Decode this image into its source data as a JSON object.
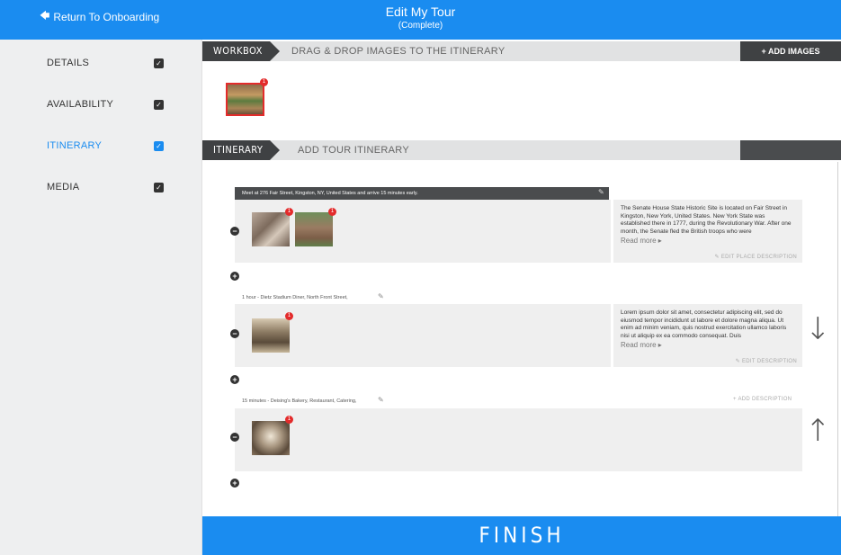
{
  "header": {
    "back_label": "Return To Onboarding",
    "title": "Edit My Tour",
    "subtitle": "(Complete)"
  },
  "sidebar": {
    "items": [
      {
        "label": "DETAILS",
        "checked": true
      },
      {
        "label": "AVAILABILITY",
        "checked": true
      },
      {
        "label": "ITINERARY",
        "checked": true,
        "active": true
      },
      {
        "label": "MEDIA",
        "checked": true
      }
    ]
  },
  "workbox": {
    "tag": "WORKBOX",
    "instruction": "DRAG & DROP IMAGES TO THE ITINERARY",
    "add_images_label": "ADD IMAGES",
    "add_icon": "+",
    "badge_count": "1"
  },
  "itinerary": {
    "tag": "ITINERARY",
    "instruction": "ADD TOUR ITINERARY",
    "stops": [
      {
        "header": "Meet at 276 Fair Street, Kingston, NY, United States and arrive 15 minutes early.",
        "badges": [
          "1",
          "1"
        ],
        "description": "The Senate House State Historic Site is located on Fair Street in Kingston, New York, United States. New York State was established there in 1777, during the Revolutionary War. After one month, the Senate fled the British troops who were",
        "read_more": "Read more ▸",
        "edit_label": "EDIT PLACE DESCRIPTION"
      },
      {
        "header": "1 hour - Dietz Stadium Diner, North Front Street,",
        "badges": [
          "1"
        ],
        "description": "Lorem ipsum dolor sit amet, consectetur adipiscing elit, sed do eiusmod tempor incididunt ut labore et dolore magna aliqua. Ut enim ad minim veniam, quis nostrud exercitation ullamco laboris nisi ut aliquip ex ea commodo consequat. Duis",
        "read_more": "Read more ▸",
        "edit_label": "EDIT DESCRIPTION"
      },
      {
        "header": "15 minutes - Deising's Bakery, Restaurant, Catering,",
        "badges": [
          "1"
        ],
        "add_description": "ADD DESCRIPTION"
      }
    ],
    "move_down": "↓",
    "move_up": "↑"
  },
  "footer": {
    "finish_label": "FINISH"
  },
  "colors": {
    "accent": "#1a8cf0",
    "dark_tag": "#3f4143",
    "badge": "#e32b2b"
  }
}
